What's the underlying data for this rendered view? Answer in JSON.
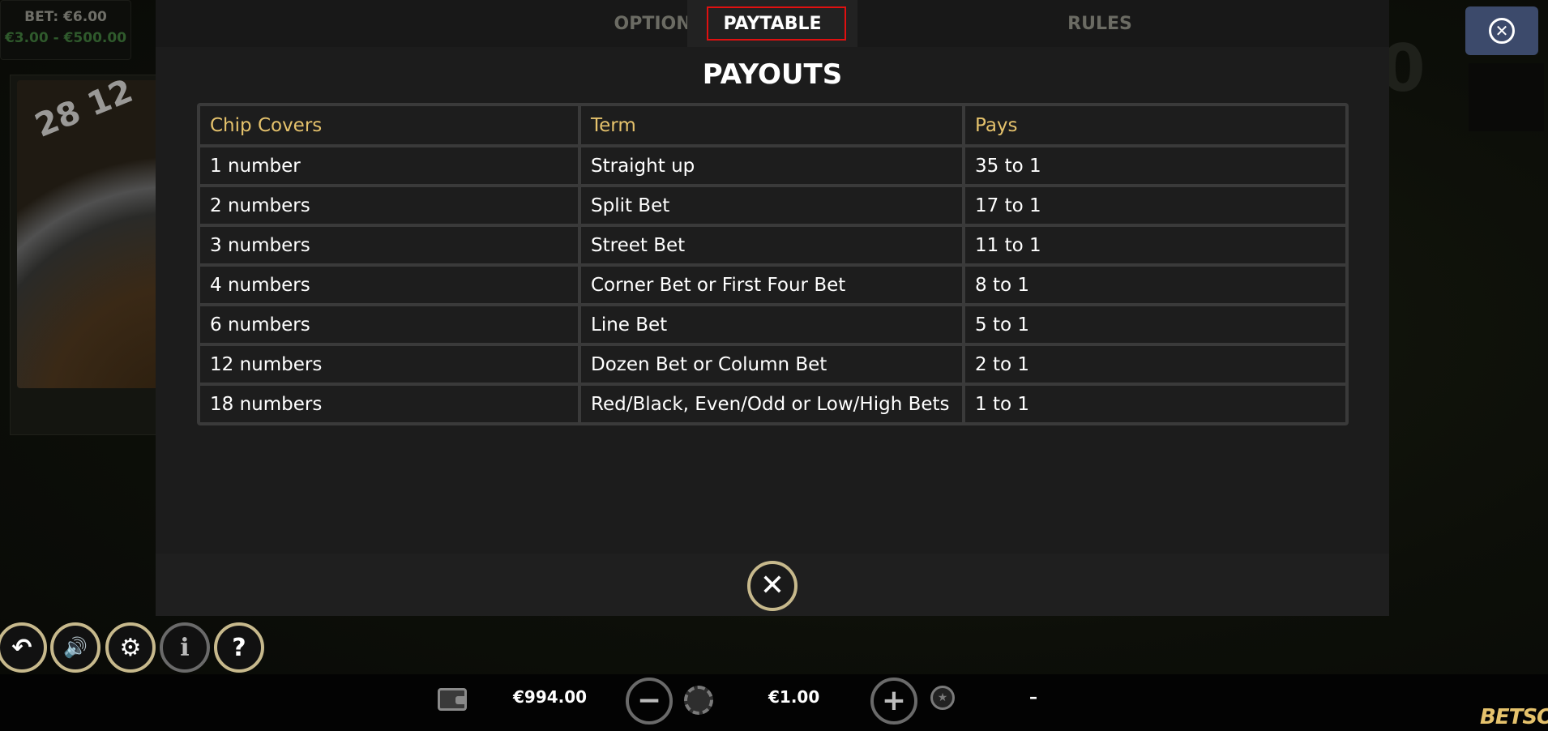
{
  "background": {
    "bet_label": "BET: €6.00",
    "bet_limits": "€3.00 - €500.00",
    "wheel_numbers": "28 12",
    "right_digit": "0"
  },
  "tabs": [
    {
      "label": "OPTIONS"
    },
    {
      "label": "PAYTABLE"
    },
    {
      "label": "RULES"
    }
  ],
  "paytable": {
    "title": "PAYOUTS",
    "headers": [
      "Chip Covers",
      "Term",
      "Pays"
    ],
    "rows": [
      [
        "1 number",
        "Straight up",
        "35 to 1"
      ],
      [
        "2 numbers",
        "Split Bet",
        "17 to 1"
      ],
      [
        "3 numbers",
        "Street Bet",
        "11 to 1"
      ],
      [
        "4 numbers",
        "Corner Bet or First Four Bet",
        "8 to 1"
      ],
      [
        "6 numbers",
        "Line Bet",
        "5 to 1"
      ],
      [
        "12 numbers",
        "Dozen Bet or Column Bet",
        "2 to 1"
      ],
      [
        "18 numbers",
        "Red/Black, Even/Odd or Low/High Bets",
        "1 to 1"
      ]
    ]
  },
  "controls": {
    "close_glyph": "✕",
    "back_glyph": "↶",
    "sound_glyph": "🔊",
    "settings_glyph": "⚙",
    "info_glyph": "i",
    "help_glyph": "?"
  },
  "bottom_bar": {
    "balance": "€994.00",
    "bet_value": "€1.00",
    "win_value": "–",
    "minus_glyph": "−",
    "plus_glyph": "+",
    "brand": "BETSOFT"
  },
  "colors": {
    "accent_gold": "#e5c26c",
    "tab_highlight": "#e01010",
    "modal_bg": "#1c1c1c"
  }
}
